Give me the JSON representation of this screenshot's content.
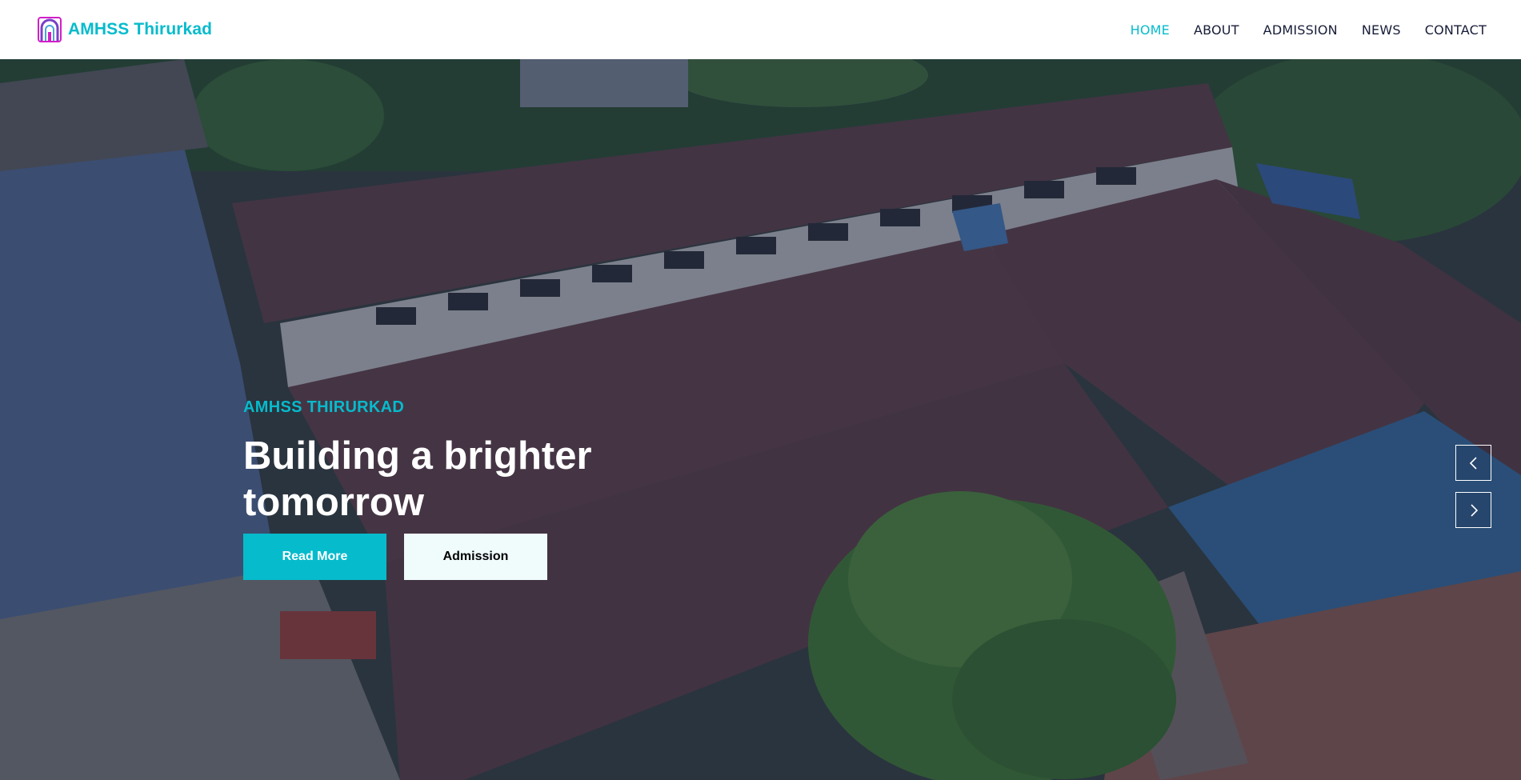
{
  "brand": {
    "name": "AMHSS Thirurkad",
    "logo_icon": "school-arch-logo-icon"
  },
  "nav": {
    "items": [
      {
        "label": "HOME",
        "active": true
      },
      {
        "label": "ABOUT",
        "active": false
      },
      {
        "label": "ADMISSION",
        "active": false
      },
      {
        "label": "NEWS",
        "active": false
      },
      {
        "label": "CONTACT",
        "active": false
      }
    ]
  },
  "hero": {
    "kicker": "AMHSS THIRURKAD",
    "headline_line1": "Building a brighter",
    "headline_line2": "tomorrow",
    "primary_button": "Read More",
    "secondary_button": "Admission",
    "prev_icon": "chevron-left-icon",
    "next_icon": "chevron-right-icon"
  },
  "colors": {
    "accent": "#06bbcc",
    "dark": "#181d38",
    "light_button": "#f0fbfc"
  }
}
